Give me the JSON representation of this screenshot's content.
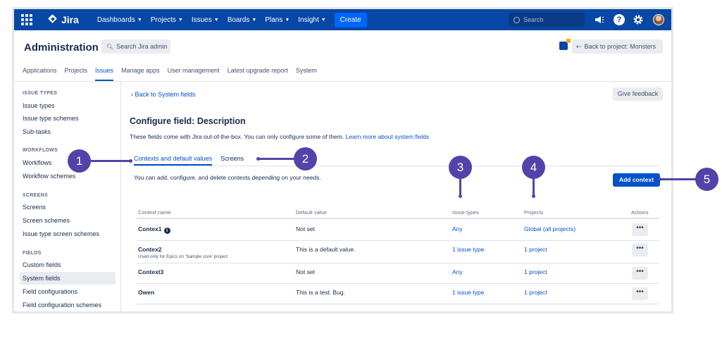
{
  "topnav": {
    "app_name": "Jira",
    "items": [
      {
        "label": "Dashboards"
      },
      {
        "label": "Projects"
      },
      {
        "label": "Issues"
      },
      {
        "label": "Boards"
      },
      {
        "label": "Plans"
      },
      {
        "label": "Insight"
      }
    ],
    "create_label": "Create",
    "search_placeholder": "Search",
    "help_glyph": "?"
  },
  "header": {
    "title": "Administration",
    "search_admin_label": "Search Jira admin",
    "back_project_label": "Back to project: Monsters"
  },
  "admin_tabs": [
    {
      "label": "Applications"
    },
    {
      "label": "Projects"
    },
    {
      "label": "Issues",
      "active": true
    },
    {
      "label": "Manage apps"
    },
    {
      "label": "User management"
    },
    {
      "label": "Latest upgrade report"
    },
    {
      "label": "System"
    }
  ],
  "sidebar": {
    "sections": [
      {
        "heading": "ISSUE TYPES",
        "items": [
          "Issue types",
          "Issue type schemes",
          "Sub-tasks"
        ]
      },
      {
        "heading": "WORKFLOWS",
        "items": [
          "Workflows",
          "Workflow schemes"
        ]
      },
      {
        "heading": "SCREENS",
        "items": [
          "Screens",
          "Screen schemes",
          "Issue type screen schemes"
        ]
      },
      {
        "heading": "FIELDS",
        "items": [
          "Custom fields",
          "System fields",
          "Field configurations",
          "Field configuration schemes"
        ]
      }
    ],
    "active_item": "System fields"
  },
  "main": {
    "back_link": "Back to System fields",
    "feedback_label": "Give feedback",
    "title": "Configure field: Description",
    "description": "These fields come with Jira out-of-the-box. You can only configure some of them.",
    "learn_more": "Learn more about system fields",
    "tabs": [
      {
        "label": "Contexts and default values",
        "active": true
      },
      {
        "label": "Screens"
      }
    ],
    "contexts_note": "You can add, configure, and delete contexts depending on your needs.",
    "add_context_label": "Add context"
  },
  "table": {
    "headers": [
      "Context name",
      "Default value",
      "Issue types",
      "Projects",
      "Actions"
    ],
    "rows": [
      {
        "name": "Contex1",
        "sub": "",
        "default": "Not set",
        "issue_types": "Any",
        "projects": "Global (all projects)",
        "info": true
      },
      {
        "name": "Contex2",
        "sub": "Used only for Epics on 'Sample core' project",
        "default": "This is a default value.",
        "issue_types": "1 issue type",
        "projects": "1 project"
      },
      {
        "name": "Context3",
        "sub": "",
        "default": "Not set",
        "issue_types": "Any",
        "projects": "1 project"
      },
      {
        "name": "Owen",
        "sub": "",
        "default": "This is a test. Bug.",
        "issue_types": "1 issue type",
        "projects": "1 project"
      }
    ],
    "actions_glyph": "•••"
  },
  "callouts": [
    "1",
    "2",
    "3",
    "4",
    "5"
  ],
  "colors": {
    "topnav_bg": "#0747a6",
    "link": "#0052cc",
    "callout": "#5243aa",
    "button_primary": "#0052cc"
  }
}
